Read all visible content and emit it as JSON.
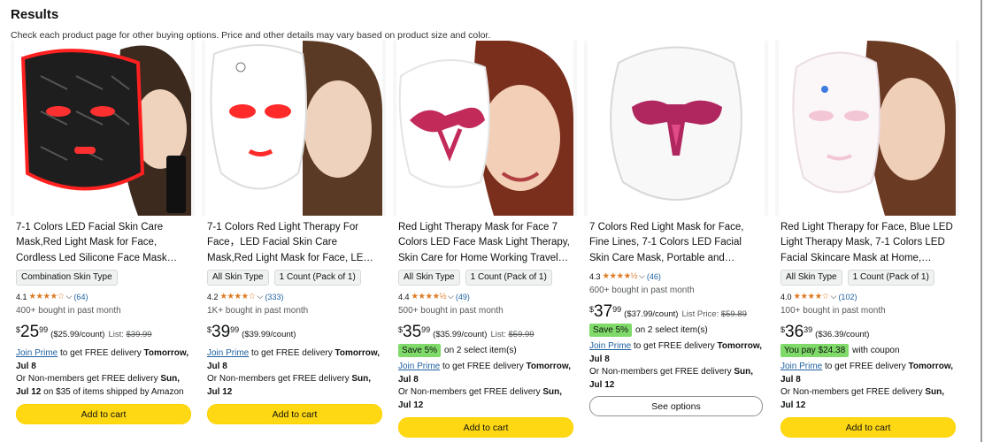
{
  "header": {
    "title": "Results",
    "subtitle": "Check each product page for other buying options. Price and other details may vary based on product size and color."
  },
  "colors": {
    "star": "#de7921",
    "link": "#2162a1",
    "button": "#ffd814",
    "save_badge": "#7fda69"
  },
  "products": [
    {
      "title": "7-1 Colors LED Facial Skin Care Mask,Red Light Mask for Face, Cordless Led Silicone Face Mask…",
      "chips": [
        "Combination Skin Type"
      ],
      "rating": "4.1",
      "stars": "★★★★☆",
      "reviews": "(64)",
      "bought": "400+ bought in past month",
      "price_symbol": "$",
      "price_whole": "25",
      "price_fraction": "99",
      "unit_price": "($25.99/count)",
      "list_label": "List:",
      "list_price": "$39.99",
      "delivery_link": "Join Prime",
      "delivery_1": " to get FREE delivery ",
      "delivery_1_bold": "Tomorrow, Jul 8",
      "delivery_2": "Or Non-members get FREE delivery ",
      "delivery_2_bold": "Sun, Jul 12",
      "delivery_2_tail": " on $35 of items shipped by Amazon",
      "button": "Add to cart"
    },
    {
      "title": "7-1 Colors Red Light Therapy For Face，LED Facial Skin Care Mask,Red Light Mask for Face, LED Facial Mas…",
      "chips": [
        "All Skin Type",
        "1 Count (Pack of 1)"
      ],
      "rating": "4.2",
      "stars": "★★★★☆",
      "reviews": "(333)",
      "bought": "1K+ bought in past month",
      "price_symbol": "$",
      "price_whole": "39",
      "price_fraction": "99",
      "unit_price": "($39.99/count)",
      "delivery_link": "Join Prime",
      "delivery_1": " to get FREE delivery ",
      "delivery_1_bold": "Tomorrow, Jul 8",
      "delivery_2": "Or Non-members get FREE delivery ",
      "delivery_2_bold": "Sun, Jul 12",
      "button": "Add to cart"
    },
    {
      "title": "Red Light Therapy Mask for Face 7 Colors LED Face Mask Light Therapy, Skin Care for Home Working Travel…",
      "chips": [
        "All Skin Type",
        "1 Count (Pack of 1)"
      ],
      "rating": "4.4",
      "stars": "★★★★½",
      "reviews": "(49)",
      "bought": "500+ bought in past month",
      "price_symbol": "$",
      "price_whole": "35",
      "price_fraction": "99",
      "unit_price": "($35.99/count)",
      "list_label": "List:",
      "list_price": "$59.99",
      "save_badge": "Save 5%",
      "save_text": "on 2 select item(s)",
      "delivery_link": "Join Prime",
      "delivery_1": " to get FREE delivery ",
      "delivery_1_bold": "Tomorrow, Jul 8",
      "delivery_2": "Or Non-members get FREE delivery ",
      "delivery_2_bold": "Sun, Jul 12",
      "button": "Add to cart"
    },
    {
      "title": "7 Colors Red Light Mask for Face, Fine Lines, 7-1 Colors LED Facial Skin Care Mask, Portable and…",
      "rating": "4.3",
      "stars": "★★★★½",
      "reviews": "(46)",
      "bought": "600+ bought in past month",
      "price_symbol": "$",
      "price_whole": "37",
      "price_fraction": "99",
      "unit_price": "($37.99/count)",
      "list_label": "List Price:",
      "list_price": "$59.89",
      "save_badge": "Save 5%",
      "save_text": "on 2 select item(s)",
      "delivery_link": "Join Prime",
      "delivery_1": " to get FREE delivery ",
      "delivery_1_bold": "Tomorrow, Jul 8",
      "delivery_2": "Or Non-members get FREE delivery ",
      "delivery_2_bold": "Sun, Jul 12",
      "button": "See options"
    },
    {
      "title": "Red Light Therapy for Face, Blue LED Light Therapy Mask, 7-1 Colors LED Facial Skincare Mask at Home, USB…",
      "chips": [
        "All Skin Type",
        "1 Count (Pack of 1)"
      ],
      "rating": "4.0",
      "stars": "★★★★☆",
      "reviews": "(102)",
      "bought": "100+ bought in past month",
      "price_symbol": "$",
      "price_whole": "36",
      "price_fraction": "39",
      "unit_price": "($36.39/count)",
      "save_badge": "You pay $24.38",
      "save_text": "with coupon",
      "delivery_link": "Join Prime",
      "delivery_1": " to get FREE delivery ",
      "delivery_1_bold": "Tomorrow, Jul 8",
      "delivery_2": "Or Non-members get FREE delivery ",
      "delivery_2_bold": "Sun, Jul 12",
      "button": "Add to cart"
    }
  ]
}
